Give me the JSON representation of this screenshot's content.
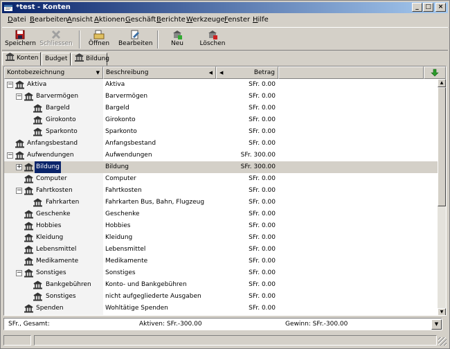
{
  "window": {
    "title": "*test - Konten"
  },
  "window_controls": {
    "minimize": "_",
    "maximize": "□",
    "close": "×"
  },
  "menu": [
    {
      "accel": "D",
      "rest": "atei"
    },
    {
      "accel": "B",
      "rest": "earbeiten"
    },
    {
      "accel": "A",
      "rest": "nsicht"
    },
    {
      "accel": "A",
      "rest": "ktionen"
    },
    {
      "accel": "G",
      "rest": "eschäft"
    },
    {
      "accel": "B",
      "rest": "erichte"
    },
    {
      "accel": "W",
      "rest": "erkzeuge"
    },
    {
      "accel": "F",
      "rest": "enster"
    },
    {
      "accel": "H",
      "rest": "ilfe"
    }
  ],
  "toolbar": {
    "save": "Speichern",
    "close": "Schliessen",
    "open": "Öffnen",
    "edit": "Bearbeiten",
    "new": "Neu",
    "delete": "Löschen"
  },
  "tabs": [
    "Konten",
    "Budget",
    "Bildung"
  ],
  "columns": {
    "name": "Kontobezeichnung",
    "description": "Beschreibung",
    "amount": "Betrag"
  },
  "accounts": [
    {
      "name": "Aktiva",
      "description": "Aktiva",
      "amount": "SFr. 0.00",
      "level": 0,
      "expander": "−"
    },
    {
      "name": "Barvermögen",
      "description": "Barvermögen",
      "amount": "SFr. 0.00",
      "level": 1,
      "expander": "−"
    },
    {
      "name": "Bargeld",
      "description": "Bargeld",
      "amount": "SFr. 0.00",
      "level": 2
    },
    {
      "name": "Girokonto",
      "description": "Girokonto",
      "amount": "SFr. 0.00",
      "level": 2
    },
    {
      "name": "Sparkonto",
      "description": "Sparkonto",
      "amount": "SFr. 0.00",
      "level": 2
    },
    {
      "name": "Anfangsbestand",
      "description": "Anfangsbestand",
      "amount": "SFr. 0.00",
      "level": 0
    },
    {
      "name": "Aufwendungen",
      "description": "Aufwendungen",
      "amount": "SFr. 300.00",
      "level": 0,
      "expander": "−"
    },
    {
      "name": "Bildung",
      "description": "Bildung",
      "amount": "SFr. 300.00",
      "level": 1,
      "expander": "+",
      "selected": true
    },
    {
      "name": "Computer",
      "description": "Computer",
      "amount": "SFr. 0.00",
      "level": 1
    },
    {
      "name": "Fahrtkosten",
      "description": "Fahrtkosten",
      "amount": "SFr. 0.00",
      "level": 1,
      "expander": "−"
    },
    {
      "name": "Fahrkarten",
      "description": "Fahrkarten Bus, Bahn, Flugzeug",
      "amount": "SFr. 0.00",
      "level": 2
    },
    {
      "name": "Geschenke",
      "description": "Geschenke",
      "amount": "SFr. 0.00",
      "level": 1
    },
    {
      "name": "Hobbies",
      "description": "Hobbies",
      "amount": "SFr. 0.00",
      "level": 1
    },
    {
      "name": "Kleidung",
      "description": "Kleidung",
      "amount": "SFr. 0.00",
      "level": 1
    },
    {
      "name": "Lebensmittel",
      "description": "Lebensmittel",
      "amount": "SFr. 0.00",
      "level": 1
    },
    {
      "name": "Medikamente",
      "description": "Medikamente",
      "amount": "SFr. 0.00",
      "level": 1
    },
    {
      "name": "Sonstiges",
      "description": "Sonstiges",
      "amount": "SFr. 0.00",
      "level": 1,
      "expander": "−"
    },
    {
      "name": "Bankgebühren",
      "description": "Konto- und Bankgebühren",
      "amount": "SFr. 0.00",
      "level": 2
    },
    {
      "name": "Sonstiges",
      "description": "nicht aufgegliederte Ausgaben",
      "amount": "SFr. 0.00",
      "level": 2
    },
    {
      "name": "Spenden",
      "description": "Wohltätige Spenden",
      "amount": "SFr. 0.00",
      "level": 1
    }
  ],
  "summary": {
    "total": "SFr., Gesamt:",
    "assets": "Aktiven: SFr.-300.00",
    "profit": "Gewinn: SFr.-300.00"
  },
  "colors": {
    "title_start": "#0a246a",
    "title_end": "#a6caf0",
    "selection": "#0a246a"
  },
  "icons": {
    "account": "bank-building-icon",
    "column_chooser": "green-arrow-down-icon"
  }
}
